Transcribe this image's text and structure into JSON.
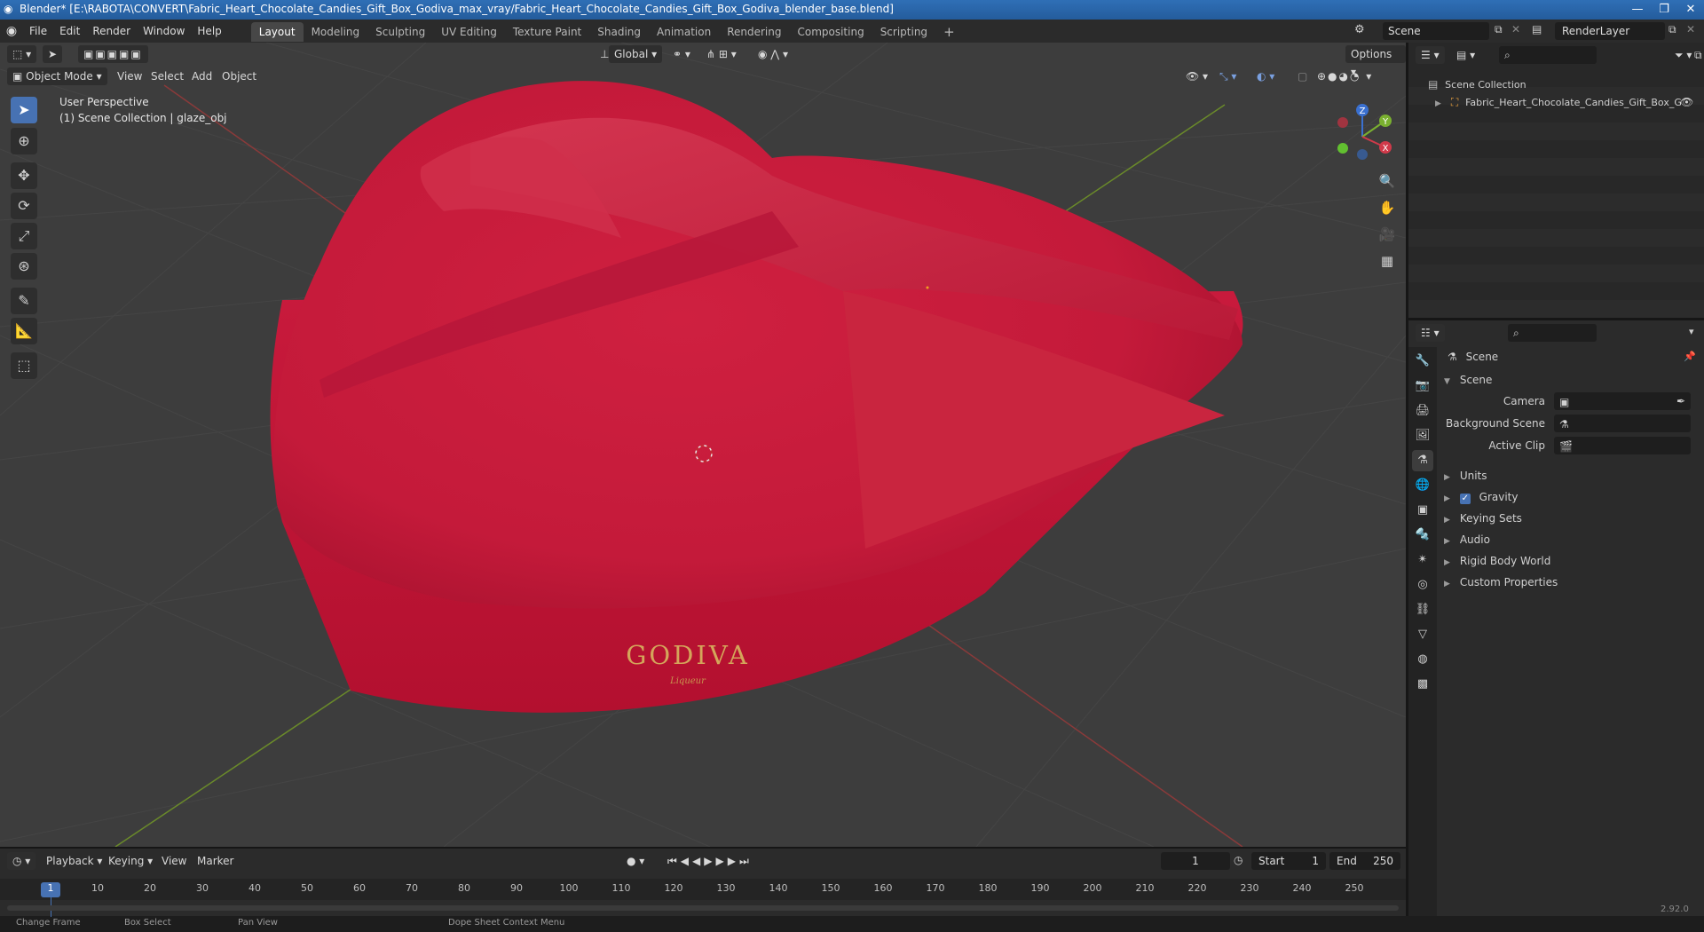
{
  "window": {
    "title": "Blender* [E:\\RABOTA\\CONVERT\\Fabric_Heart_Chocolate_Candies_Gift_Box_Godiva_max_vray/Fabric_Heart_Chocolate_Candies_Gift_Box_Godiva_blender_base.blend]",
    "icons": [
      "blender-logo-icon",
      "minimize-icon",
      "maximize-icon",
      "close-icon"
    ]
  },
  "menubar": {
    "menus": [
      "File",
      "Edit",
      "Render",
      "Window",
      "Help"
    ],
    "workspaces": [
      "Layout",
      "Modeling",
      "Sculpting",
      "UV Editing",
      "Texture Paint",
      "Shading",
      "Animation",
      "Rendering",
      "Compositing",
      "Scripting"
    ],
    "active_workspace": "Layout",
    "add_workspace": "+",
    "scene_name": "Scene",
    "render_layer": "RenderLayer"
  },
  "viewport": {
    "transform_orientation": "Global",
    "options_label": "Options",
    "mode": "Object Mode",
    "header_menus": [
      "View",
      "Select",
      "Add",
      "Object"
    ],
    "overlay_line1": "User Perspective",
    "overlay_line2": "(1) Scene Collection | glaze_obj",
    "gizmo_axes": [
      "Z",
      "Y",
      "X"
    ],
    "box_text_main": "GODIVA",
    "box_text_sub": "Liqueur",
    "colors": {
      "background": "#3d3d3d",
      "grid": "#454545",
      "x_axis": "#8a3a3a",
      "y_axis": "#6a8a2a",
      "box_red": "#c4183a",
      "accent": "#4772b3"
    }
  },
  "timeline": {
    "menus": [
      "Playback",
      "Keying",
      "View",
      "Marker"
    ],
    "current_frame": "1",
    "start_label": "Start",
    "start_value": "1",
    "end_label": "End",
    "end_value": "250",
    "ruler": [
      "1",
      "10",
      "20",
      "30",
      "40",
      "50",
      "60",
      "70",
      "80",
      "90",
      "100",
      "110",
      "120",
      "130",
      "140",
      "150",
      "160",
      "170",
      "180",
      "190",
      "200",
      "210",
      "220",
      "230",
      "240",
      "250"
    ],
    "status": [
      "Change Frame",
      "Box Select",
      "Pan View",
      "Dope Sheet Context Menu"
    ],
    "version": "2.92.0"
  },
  "outliner": {
    "root": "Scene Collection",
    "items": [
      {
        "label": "Fabric_Heart_Chocolate_Candies_Gift_Box_G",
        "icon": "object-icon"
      }
    ]
  },
  "properties": {
    "header": "Scene",
    "panel": "Scene",
    "fields": [
      {
        "label": "Camera",
        "value": ""
      },
      {
        "label": "Background Scene",
        "value": ""
      },
      {
        "label": "Active Clip",
        "value": ""
      }
    ],
    "subpanels": [
      "Units",
      "Gravity",
      "Keying Sets",
      "Audio",
      "Rigid Body World",
      "Custom Properties"
    ],
    "gravity_checked": true
  }
}
